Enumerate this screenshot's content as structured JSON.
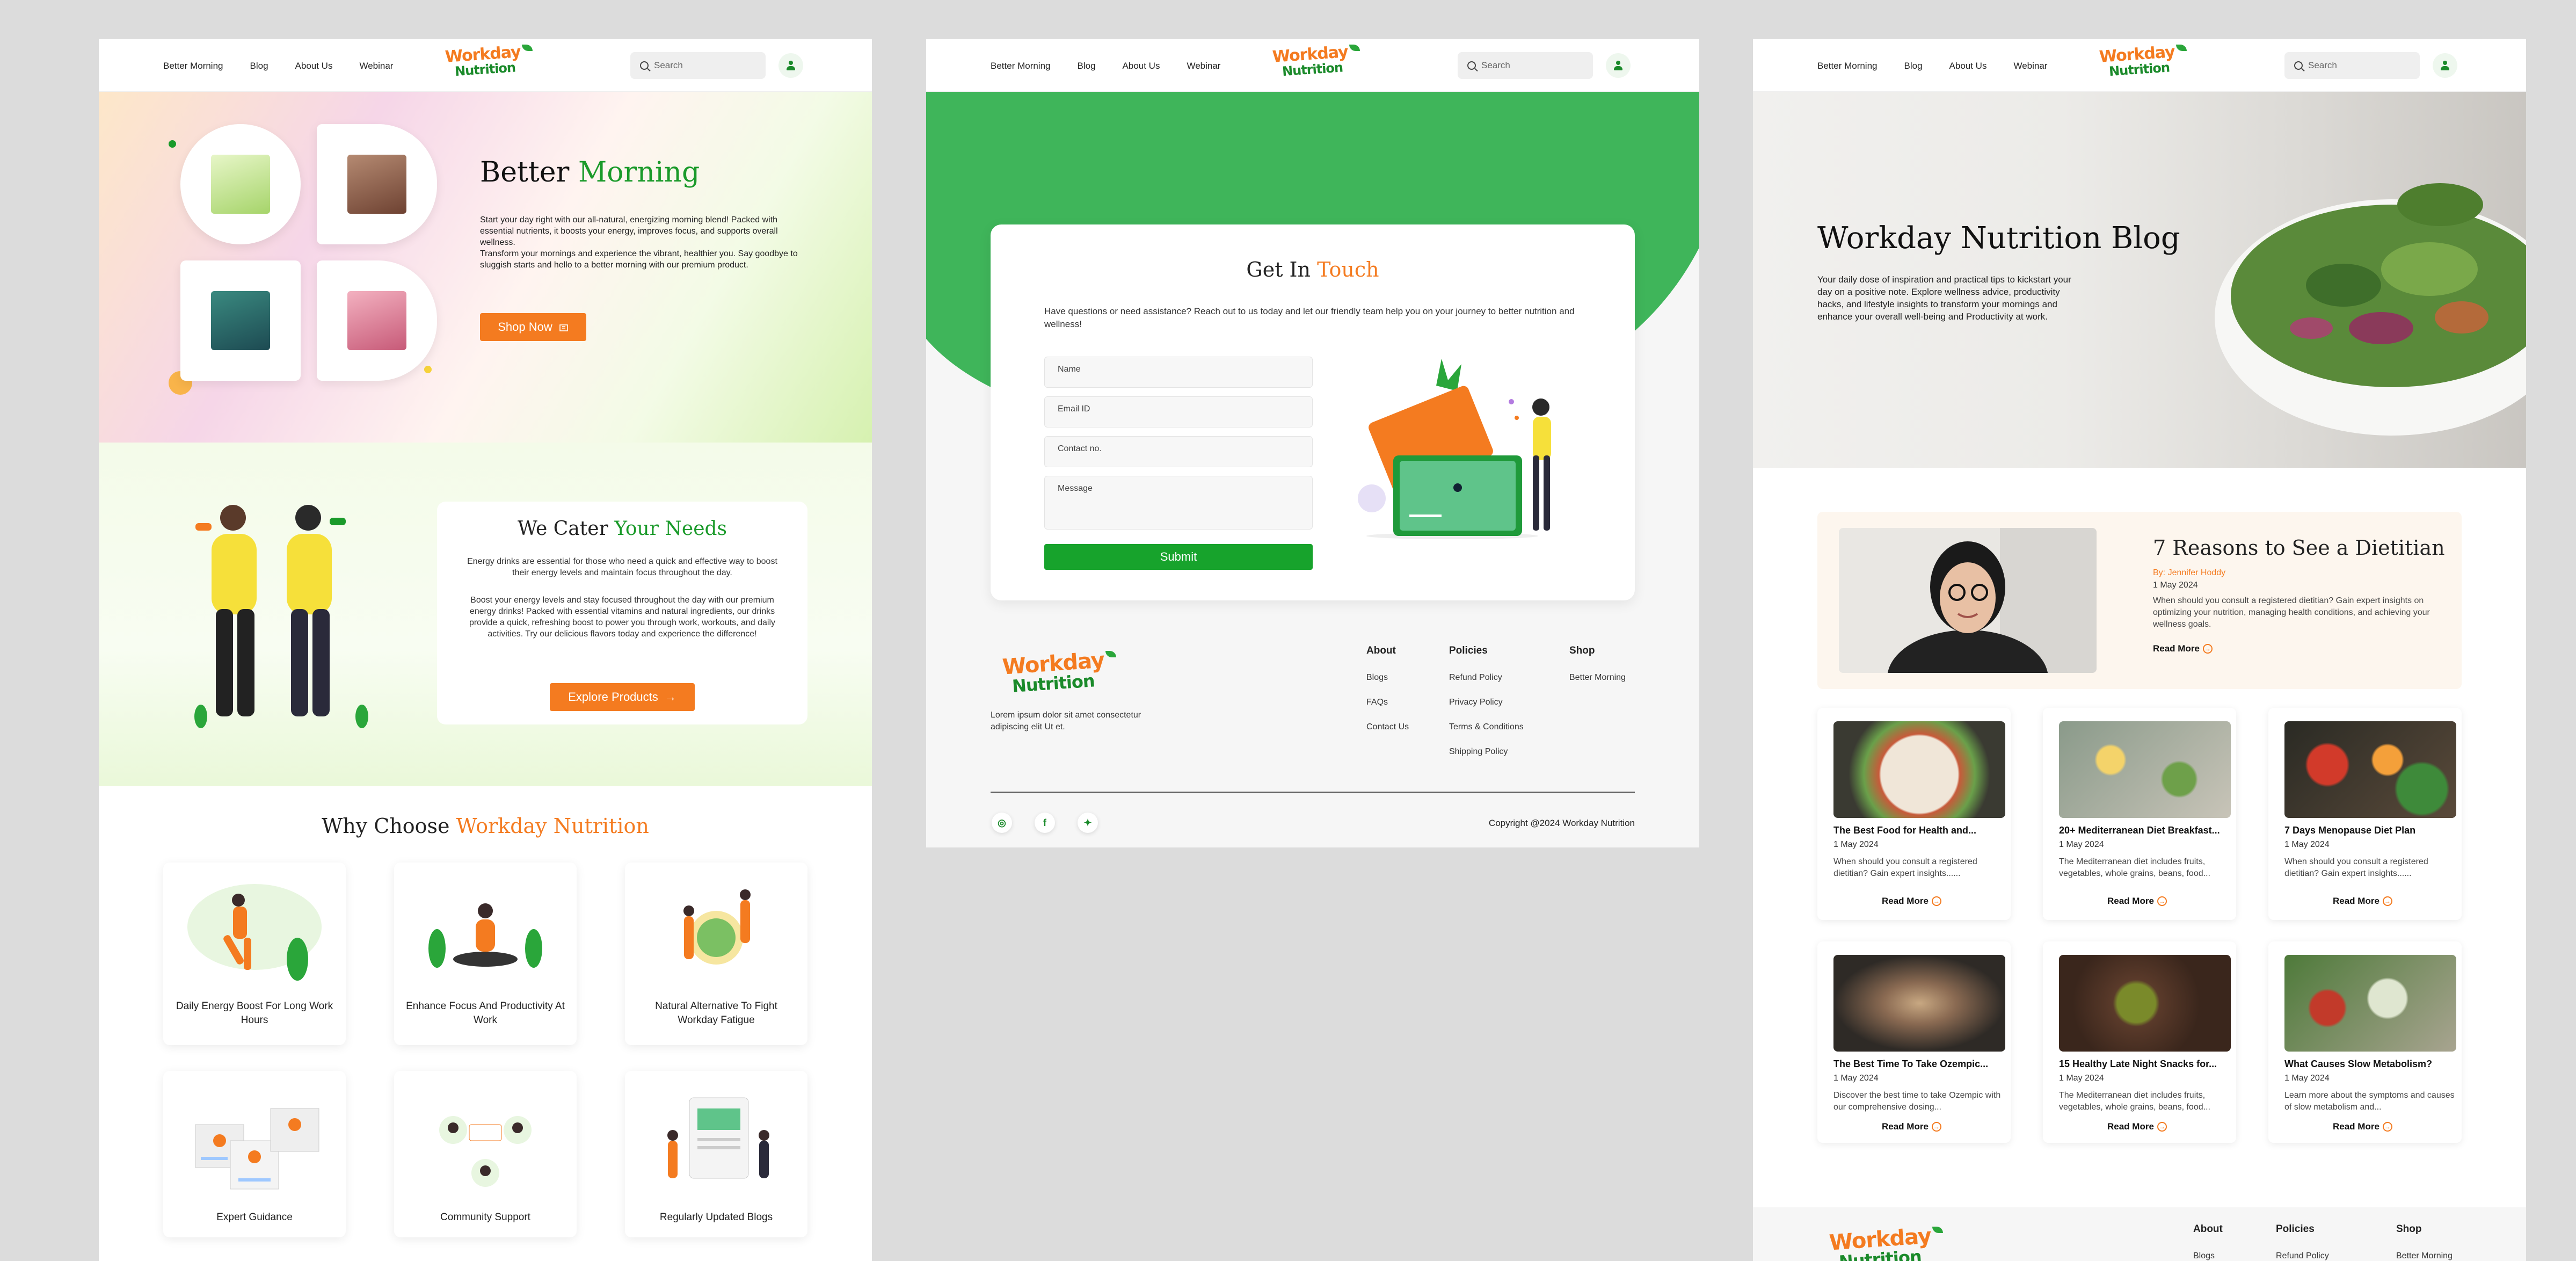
{
  "nav": {
    "links": [
      "Better Morning",
      "Blog",
      "About Us",
      "Webinar"
    ],
    "search_placeholder": "Search",
    "logo_line1": "Workday",
    "logo_line2": "Nutrition"
  },
  "home": {
    "hero": {
      "title_plain": "Better",
      "title_accent": "Morning",
      "body_1": "Start your day right with our all-natural, energizing morning blend! Packed with essential nutrients, it boosts your energy, improves focus, and supports overall wellness.",
      "body_2": "Transform your mornings and experience the vibrant, healthier you. Say goodbye to sluggish starts and hello to a better morning with our premium product.",
      "cta": "Shop Now"
    },
    "cater": {
      "title_plain": "We Cater",
      "title_accent": "Your Needs",
      "body_1": "Energy drinks are essential for those who need a quick and effective way to boost their energy levels and maintain focus throughout the day.",
      "body_2": "Boost your energy levels and stay focused throughout the day with our premium energy drinks! Packed with essential vitamins and natural ingredients, our drinks provide a quick, refreshing boost to power you through work, workouts, and daily activities. Try our delicious flavors today and experience the difference!",
      "cta": "Explore Products"
    },
    "why": {
      "title_plain": "Why Choose",
      "title_accent": "Workday Nutrition",
      "features": [
        "Daily Energy Boost For Long Work Hours",
        "Enhance Focus And Productivity At Work",
        "Natural Alternative To Fight Workday Fatigue",
        "Expert Guidance",
        "Community Support",
        "Regularly Updated Blogs"
      ]
    }
  },
  "contact": {
    "title_plain": "Get In",
    "title_accent": "Touch",
    "intro": "Have questions or need assistance? Reach out to us today and let our friendly team help you on your journey to better nutrition and wellness!",
    "fields": [
      "Name",
      "Email ID",
      "Contact no.",
      "Message"
    ],
    "submit": "Submit"
  },
  "footer": {
    "tagline": "Lorem ipsum dolor sit amet consectetur adipiscing elit Ut et.",
    "columns": [
      {
        "title": "About",
        "items": [
          "Blogs",
          "FAQs",
          "Contact Us"
        ]
      },
      {
        "title": "Policies",
        "items": [
          "Refund Policy",
          "Privacy Policy",
          "Terms & Conditions",
          "Shipping Policy"
        ]
      },
      {
        "title": "Shop",
        "items": [
          "Better Morning"
        ]
      }
    ],
    "copyright": "Copyright @2024 Workday Nutrition"
  },
  "blog": {
    "title": "Workday Nutrition Blog",
    "intro": "Your daily dose of inspiration and practical tips to kickstart your day on a positive note. Explore wellness advice, productivity hacks, and lifestyle insights to transform your mornings and enhance your overall well-being and Productivity at work.",
    "featured": {
      "title": "7 Reasons to See a Dietitian",
      "author": "By: Jennifer Hoddy",
      "date": "1 May 2024",
      "excerpt": "When should you consult a registered dietitian? Gain expert insights on optimizing your nutrition, managing health conditions, and achieving your wellness goals.",
      "cta": "Read More"
    },
    "read_more": "Read More",
    "posts": [
      {
        "title": "The Best Food for Health and...",
        "date": "1 May 2024",
        "excerpt": "When should you consult a registered dietitian? Gain expert insights......"
      },
      {
        "title": "20+ Mediterranean Diet Breakfast...",
        "date": "1 May 2024",
        "excerpt": "The Mediterranean diet includes fruits, vegetables, whole grains, beans, food..."
      },
      {
        "title": "7 Days Menopause Diet Plan",
        "date": "1 May 2024",
        "excerpt": "When should you consult a registered dietitian? Gain expert insights......"
      },
      {
        "title": "The Best Time To Take Ozempic...",
        "date": "1 May 2024",
        "excerpt": "Discover the best time to take Ozempic with our comprehensive dosing..."
      },
      {
        "title": "15 Healthy Late Night Snacks for...",
        "date": "1 May 2024",
        "excerpt": "The Mediterranean diet includes fruits, vegetables, whole grains, beans, food..."
      },
      {
        "title": "What Causes Slow Metabolism?",
        "date": "1 May 2024",
        "excerpt": "Learn more about the symptoms and causes of slow metabolism and..."
      }
    ]
  },
  "colors": {
    "brand_green": "#1a9a2a",
    "brand_orange": "#f47b20"
  }
}
